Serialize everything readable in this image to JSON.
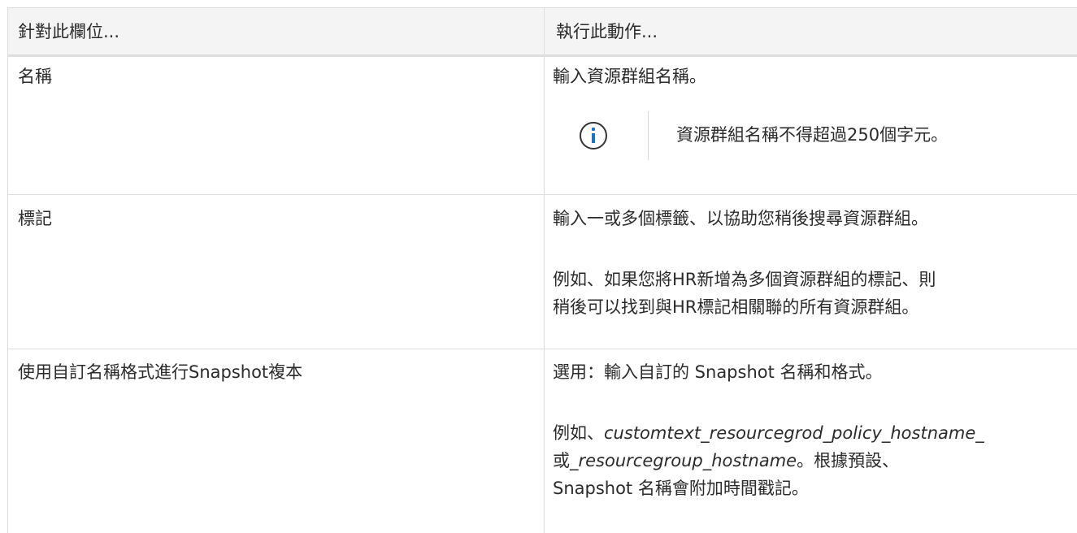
{
  "table": {
    "headers": [
      "針對此欄位...",
      "執行此動作..."
    ],
    "rows": [
      {
        "field": "名稱",
        "action_line1": "輸入資源群組名稱。",
        "note": "資源群組名稱不得超過250個字元。"
      },
      {
        "field": "標記",
        "action_line1": "輸入一或多個標籤、以協助您稍後搜尋資源群組。",
        "action_line2": "例如、如果您將HR新增為多個資源群組的標記、則",
        "action_line3": "稍後可以找到與HR標記相關聯的所有資源群組。"
      },
      {
        "field": "使用自訂名稱格式進行Snapshot複本",
        "action_line1": "選用：輸入自訂的 Snapshot 名稱和格式。",
        "example_prefix": "例如、",
        "example_italic1": "customtext_resourcegrod_policy_hostname_",
        "example_mid": "或",
        "example_italic2": "_resourcegroup_hostname",
        "example_suffix": "。根據預設、",
        "action_line4": "Snapshot 名稱會附加時間戳記。"
      }
    ]
  },
  "icons": {
    "note": "info-icon"
  },
  "colors": {
    "header_bg": "#f4f4f4",
    "border": "#dedede",
    "icon_accent": "#1a73c8"
  }
}
